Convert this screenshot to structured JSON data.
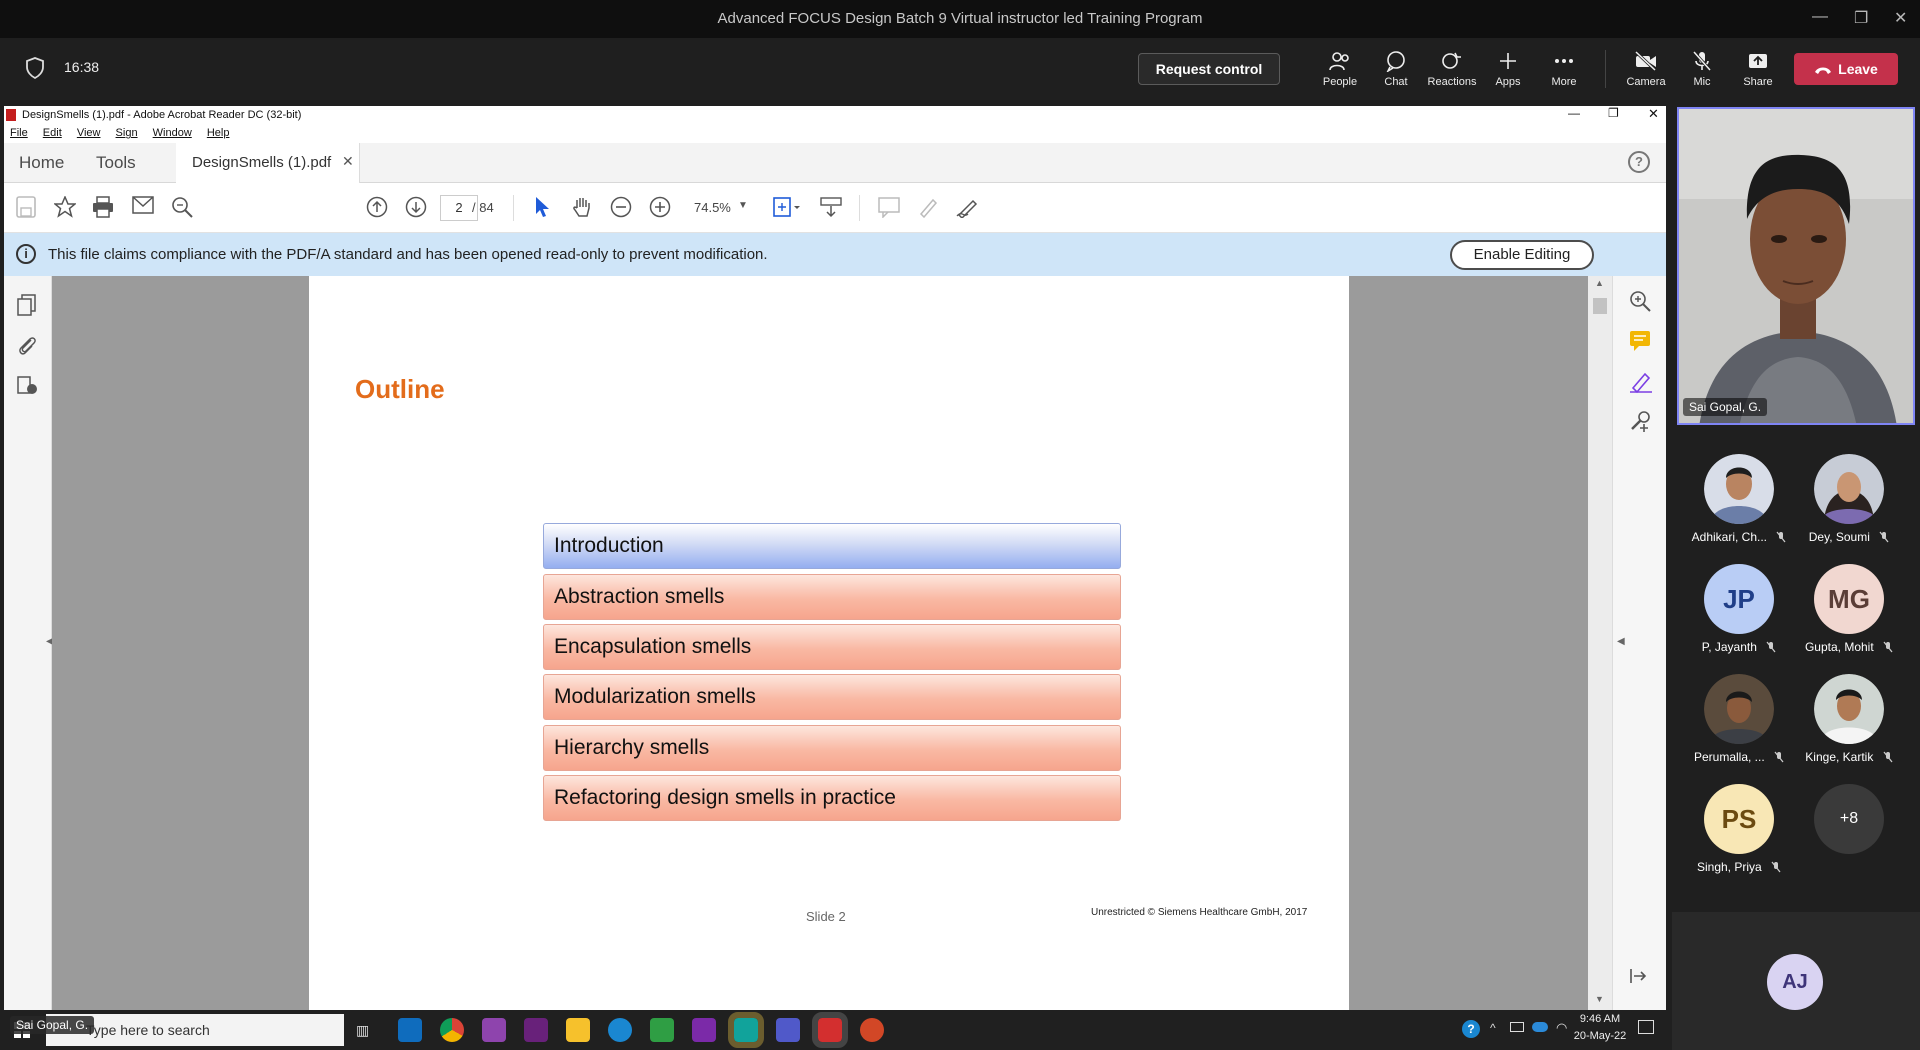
{
  "teams": {
    "window_title": "Advanced FOCUS Design Batch 9 Virtual instructor led Training Program",
    "time": "16:38",
    "request_control": "Request control",
    "toolbar": [
      {
        "label": "People",
        "icon": "people-icon"
      },
      {
        "label": "Chat",
        "icon": "chat-icon"
      },
      {
        "label": "Reactions",
        "icon": "reactions-icon"
      },
      {
        "label": "Apps",
        "icon": "plus-icon"
      },
      {
        "label": "More",
        "icon": "more-icon"
      }
    ],
    "devices": [
      {
        "label": "Camera",
        "icon": "camera-off-icon"
      },
      {
        "label": "Mic",
        "icon": "mic-off-icon"
      },
      {
        "label": "Share",
        "icon": "share-icon"
      }
    ],
    "leave": "Leave",
    "leave_color": "#c4314b",
    "presenter_name": "Sai Gopal, G.",
    "participants": [
      {
        "name": "Adhikari, Ch...",
        "initials": "",
        "photo": true
      },
      {
        "name": "Dey, Soumi",
        "initials": "",
        "photo": true
      },
      {
        "name": "P, Jayanth",
        "initials": "JP",
        "color": "#b9cdf5",
        "text_color": "#1f3e88"
      },
      {
        "name": "Gupta, Mohit",
        "initials": "MG",
        "color": "#f1d7d0",
        "text_color": "#5a3d36"
      },
      {
        "name": "Perumalla, ...",
        "initials": "",
        "photo": true
      },
      {
        "name": "Kinge, Kartik",
        "initials": "",
        "photo": true
      },
      {
        "name": "Singh, Priya",
        "initials": "PS",
        "color": "#f8e7b5",
        "text_color": "#6b4a10"
      },
      {
        "name": "",
        "initials": "+8",
        "color": "#3a3a3a",
        "text_color": "#ffffff"
      }
    ],
    "extra_avatar": "AJ"
  },
  "acrobat": {
    "title": "DesignSmells (1).pdf - Adobe Acrobat Reader DC (32-bit)",
    "menu": [
      "File",
      "Edit",
      "View",
      "Sign",
      "Window",
      "Help"
    ],
    "tabs": {
      "home": "Home",
      "tools": "Tools",
      "doc": "DesignSmells (1).pdf"
    },
    "page_current": "2",
    "page_total": "/ 84",
    "zoom": "74.5%",
    "banner_text": "This file claims compliance with the PDF/A standard and has been opened read-only to prevent modification.",
    "enable_editing": "Enable Editing"
  },
  "slide": {
    "title": "Outline",
    "items": [
      "Introduction",
      "Abstraction smells",
      "Encapsulation smells",
      "Modularization smells",
      "Hierarchy smells",
      "Refactoring design smells in practice"
    ],
    "slide_label": "Slide 2",
    "copyright": "Unrestricted © Siemens Healthcare GmbH, 2017"
  },
  "taskbar": {
    "search_placeholder": "Type here to search",
    "name_overlay": "Sai Gopal, G.",
    "time": "9:46 AM",
    "date": "20-May-22"
  }
}
